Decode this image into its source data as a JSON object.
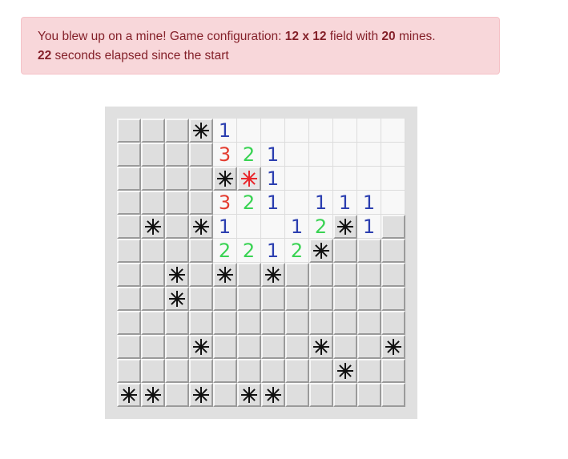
{
  "status": {
    "line1_prefix": "You blew up on a mine! Game configuration: ",
    "field_size": "12 x 12",
    "line1_mid": " field with ",
    "mine_count": "20",
    "line1_suffix": " mines.",
    "elapsed_seconds": "22",
    "line2_suffix": " seconds elapsed since the start"
  },
  "colors": {
    "alert_bg": "#f8d7da",
    "alert_text": "#842029",
    "n1": "#2c3fb0",
    "n2": "#39d353",
    "n3": "#e33b2e",
    "mine": "#111111",
    "mine_exploded": "#e8262b"
  },
  "board": {
    "rows": 12,
    "cols": 12,
    "cells": [
      [
        "C",
        "C",
        "C",
        "M",
        "1",
        ".",
        ".",
        ".",
        ".",
        ".",
        ".",
        "."
      ],
      [
        "C",
        "C",
        "C",
        "C",
        "3",
        "2",
        "1",
        ".",
        ".",
        ".",
        ".",
        "."
      ],
      [
        "C",
        "C",
        "C",
        "C",
        "M",
        "X",
        "1",
        ".",
        ".",
        ".",
        ".",
        "."
      ],
      [
        "C",
        "C",
        "C",
        "C",
        "3",
        "2",
        "1",
        ".",
        "1",
        "1",
        "1",
        "."
      ],
      [
        "C",
        "M",
        "C",
        "M",
        "1",
        ".",
        ".",
        "1",
        "2",
        "M",
        "1",
        "C"
      ],
      [
        "C",
        "C",
        "C",
        "C",
        "2",
        "2",
        "1",
        "2",
        "M",
        "C",
        "C",
        "C"
      ],
      [
        "C",
        "C",
        "M",
        "C",
        "M",
        "C",
        "M",
        "C",
        "C",
        "C",
        "C",
        "C"
      ],
      [
        "C",
        "C",
        "M",
        "C",
        "C",
        "C",
        "C",
        "C",
        "C",
        "C",
        "C",
        "C"
      ],
      [
        "C",
        "C",
        "C",
        "C",
        "C",
        "C",
        "C",
        "C",
        "C",
        "C",
        "C",
        "C"
      ],
      [
        "C",
        "C",
        "C",
        "M",
        "C",
        "C",
        "C",
        "C",
        "M",
        "C",
        "C",
        "M"
      ],
      [
        "C",
        "C",
        "C",
        "C",
        "C",
        "C",
        "C",
        "C",
        "C",
        "M",
        "C",
        "C"
      ],
      [
        "M",
        "M",
        "C",
        "M",
        "C",
        "M",
        "M",
        "C",
        "C",
        "C",
        "C",
        "C"
      ]
    ]
  }
}
